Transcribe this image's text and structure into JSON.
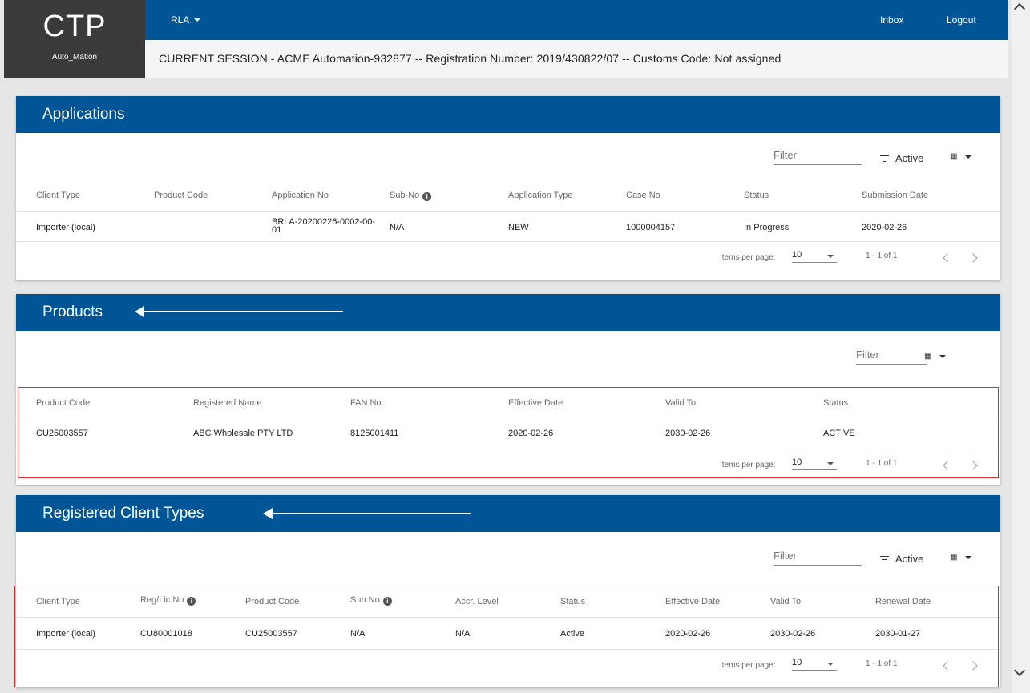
{
  "brand": {
    "title": "CTP",
    "subtitle": "Auto_Mation"
  },
  "topbar": {
    "menu_label": "RLA",
    "inbox": "Inbox",
    "logout": "Logout"
  },
  "session": "CURRENT SESSION - ACME Automation-932877 -- Registration Number: 2019/430822/07 -- Customs Code: Not assigned",
  "applications": {
    "title": "Applications",
    "filter_placeholder": "Filter",
    "active_label": "Active",
    "columns": [
      "Client Type",
      "Product Code",
      "Application No",
      "Sub-No",
      "Application Type",
      "Case No",
      "Status",
      "Submission Date"
    ],
    "rows": [
      {
        "client_type": "Importer (local)",
        "product_code": "",
        "application_no": "BRLA-20200226-0002-00-\n01",
        "sub_no": "N/A",
        "application_type": "NEW",
        "case_no": "1000004157",
        "status": "In Progress",
        "submission_date": "2020-02-26"
      }
    ],
    "pager": {
      "items_per_page_label": "Items per page:",
      "items_per_page": "10",
      "range": "1 - 1 of 1"
    }
  },
  "products": {
    "title": "Products",
    "filter_placeholder": "Filter",
    "columns": [
      "Product Code",
      "Registered Name",
      "FAN No",
      "Effective Date",
      "Valid To",
      "Status"
    ],
    "rows": [
      {
        "product_code": "CU25003557",
        "registered_name": "ABC Wholesale PTY LTD",
        "fan_no": "8125001411",
        "effective_date": "2020-02-26",
        "valid_to": "2030-02-26",
        "status": "ACTIVE"
      }
    ],
    "pager": {
      "items_per_page_label": "Items per page:",
      "items_per_page": "10",
      "range": "1 - 1 of 1"
    }
  },
  "client_types": {
    "title": "Registered Client Types",
    "filter_placeholder": "Filter",
    "active_label": "Active",
    "columns": [
      "Client Type",
      "Reg/Lic No",
      "Product Code",
      "Sub No",
      "Accr. Level",
      "Status",
      "Effective Date",
      "Valid To",
      "Renewal Date"
    ],
    "rows": [
      {
        "client_type": "Importer (local)",
        "reg_lic_no": "CU80001018",
        "product_code": "CU25003557",
        "sub_no": "N/A",
        "accr_level": "N/A",
        "status": "Active",
        "effective_date": "2020-02-26",
        "valid_to": "2030-02-26",
        "renewal_date": "2030-01-27"
      }
    ],
    "pager": {
      "items_per_page_label": "Items per page:",
      "items_per_page": "10",
      "range": "1 - 1 of 1"
    }
  },
  "colors": {
    "header_blue": "#005596",
    "logo_bg": "#3a3a3a",
    "highlight_red": "#d32f2f"
  }
}
